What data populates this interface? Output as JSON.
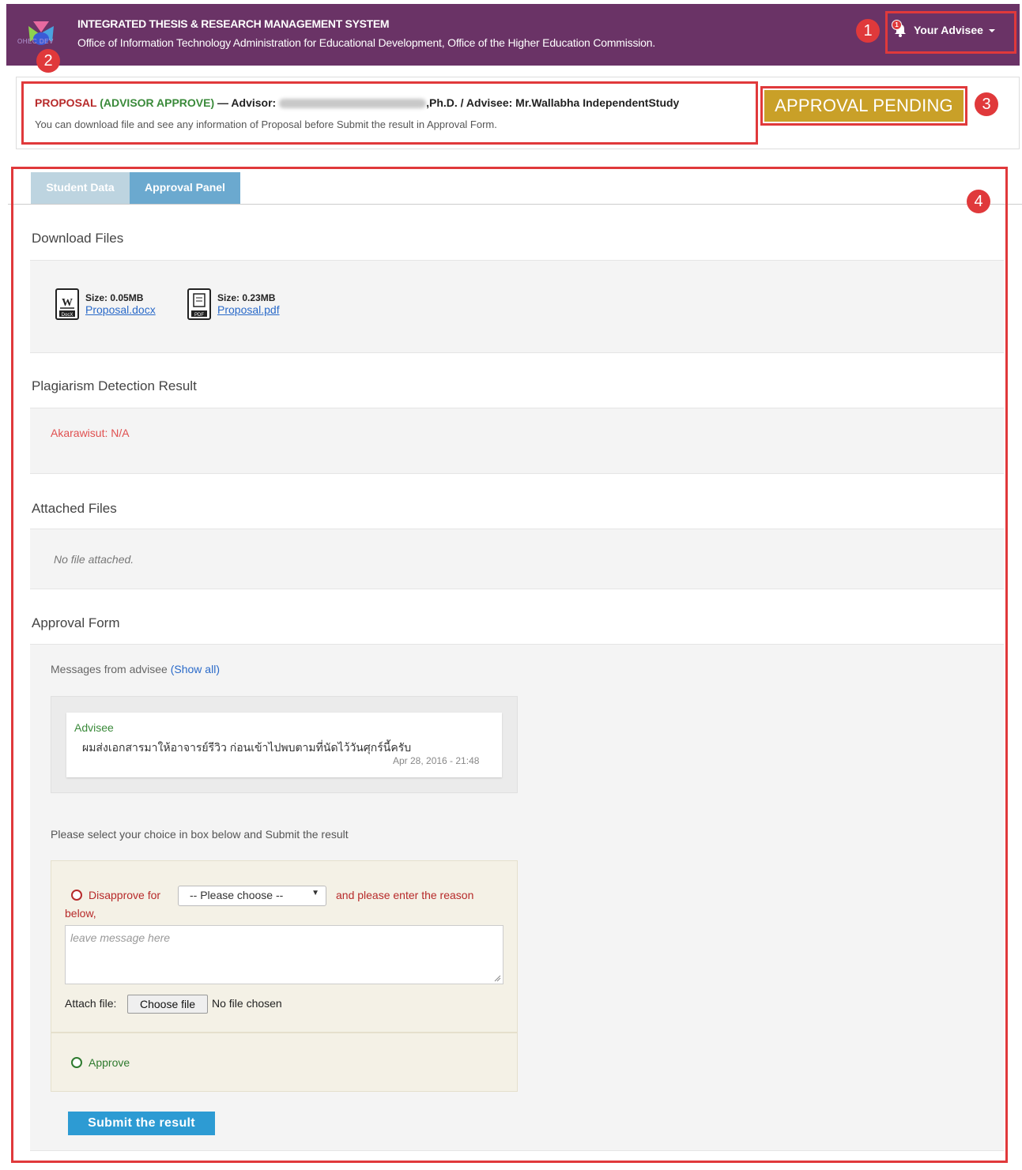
{
  "header": {
    "title": "INTEGRATED THESIS & RESEARCH MANAGEMENT SYSTEM",
    "subtitle": "Office of Information Technology Administration for Educational Development, Office of the Higher Education Commission.",
    "logo_text": "OHEC DEV",
    "advisee_menu_label": "Your Advisee",
    "notification_count": "1"
  },
  "markers": [
    "1",
    "2",
    "3",
    "4"
  ],
  "proposal": {
    "type": "PROPOSAL",
    "status_paren": "(ADVISOR APPROVE)",
    "dash": " — ",
    "advisor_prefix": "Advisor: ",
    "advisor_suffix": ",Ph.D. / Advisee: Mr.Wallabha IndependentStudy",
    "description": "You can download file and see any information of Proposal before Submit the result in Approval Form.",
    "badge": "APPROVAL PENDING"
  },
  "tabs": [
    {
      "label": "Student Data",
      "active": false
    },
    {
      "label": "Approval Panel",
      "active": true
    }
  ],
  "download": {
    "heading": "Download Files",
    "files": [
      {
        "size": "Size: 0.05MB",
        "name": "Proposal.docx",
        "icon": "word-docx-icon"
      },
      {
        "size": "Size: 0.23MB",
        "name": "Proposal.pdf",
        "icon": "pdf-icon"
      }
    ]
  },
  "plagiarism": {
    "heading": "Plagiarism Detection Result",
    "result": "Akarawisut: N/A"
  },
  "attached": {
    "heading": "Attached Files",
    "empty_text": "No file attached."
  },
  "approval_form": {
    "heading": "Approval Form",
    "messages_label": "Messages from advisee ",
    "show_all": "(Show all)",
    "message": {
      "sender": "Advisee",
      "text": "ผมส่งเอกสารมาให้อาจารย์รีวิว ก่อนเข้าไปพบตามที่นัดไว้วันศุกร์นี้ครับ",
      "timestamp": "Apr 28, 2016 - 21:48"
    },
    "instruction": "Please select your choice in box below and Submit the result",
    "disapprove_label": "Disapprove for",
    "select_value": "-- Please choose --",
    "reason_suffix": "and please enter the reason",
    "reason_suffix2": "below,",
    "textarea_placeholder": "leave message here",
    "attach_label": "Attach file:",
    "choose_file": "Choose file",
    "no_file": "No file chosen",
    "approve_label": "Approve",
    "submit_label": "Submit the result"
  },
  "colors": {
    "header_bg": "#6a3366",
    "highlight_red": "#e0393b",
    "badge_gold": "#c9a028",
    "tab_active": "#6ba9cf",
    "submit_blue": "#2d9bd3"
  }
}
